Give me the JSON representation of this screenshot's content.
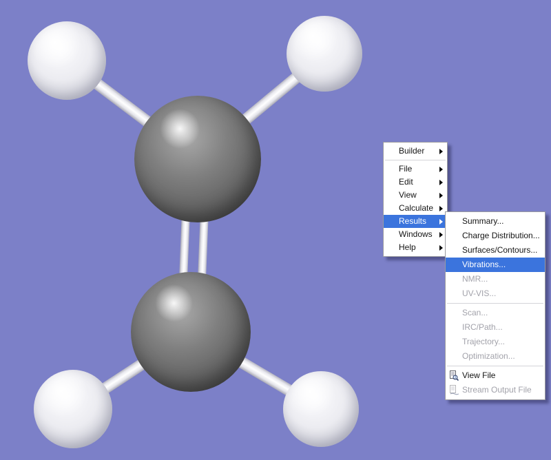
{
  "scene": {
    "background_color": "#7c80c8",
    "carbon_color": "#6f6f6f",
    "hydrogen_color": "#f0f0f4",
    "bond_color": "#ececf0",
    "highlight_color": "#3b74dd"
  },
  "context_menu": {
    "items": [
      {
        "label": "Builder",
        "has_submenu": true,
        "state": "enabled"
      },
      {
        "label": "File",
        "has_submenu": true,
        "state": "enabled"
      },
      {
        "label": "Edit",
        "has_submenu": true,
        "state": "enabled"
      },
      {
        "label": "View",
        "has_submenu": true,
        "state": "enabled"
      },
      {
        "label": "Calculate",
        "has_submenu": true,
        "state": "enabled"
      },
      {
        "label": "Results",
        "has_submenu": true,
        "state": "highlighted"
      },
      {
        "label": "Windows",
        "has_submenu": true,
        "state": "enabled"
      },
      {
        "label": "Help",
        "has_submenu": true,
        "state": "enabled"
      }
    ]
  },
  "results_submenu": {
    "items": [
      {
        "label": "Summary...",
        "state": "enabled"
      },
      {
        "label": "Charge Distribution...",
        "state": "enabled"
      },
      {
        "label": "Surfaces/Contours...",
        "state": "enabled"
      },
      {
        "label": "Vibrations...",
        "state": "highlighted"
      },
      {
        "label": "NMR...",
        "state": "disabled"
      },
      {
        "label": "UV-VIS...",
        "state": "disabled"
      },
      {
        "label": "Scan...",
        "state": "disabled"
      },
      {
        "label": "IRC/Path...",
        "state": "disabled"
      },
      {
        "label": "Trajectory...",
        "state": "disabled"
      },
      {
        "label": "Optimization...",
        "state": "disabled"
      },
      {
        "label": "View File",
        "state": "enabled",
        "icon": "view-file-icon"
      },
      {
        "label": "Stream Output File",
        "state": "disabled",
        "icon": "stream-output-icon"
      }
    ]
  }
}
